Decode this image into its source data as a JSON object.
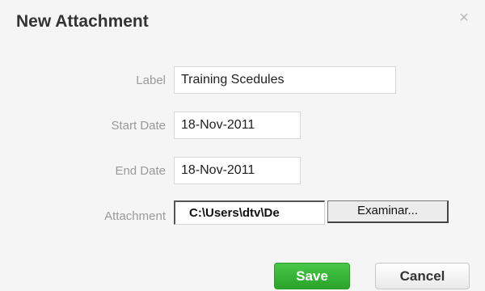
{
  "dialog": {
    "title": "New Attachment",
    "close_glyph": "×"
  },
  "form": {
    "label": {
      "label": "Label",
      "value": "Training Scedules"
    },
    "start_date": {
      "label": "Start Date",
      "value": "18-Nov-2011"
    },
    "end_date": {
      "label": "End Date",
      "value": "18-Nov-2011"
    },
    "attachment": {
      "label": "Attachment",
      "path": "C:\\Users\\dtv\\De",
      "browse_label": "Examinar..."
    }
  },
  "buttons": {
    "save": "Save",
    "cancel": "Cancel"
  },
  "colors": {
    "save_button": "#35b335",
    "label_text": "#9a9a9a"
  }
}
